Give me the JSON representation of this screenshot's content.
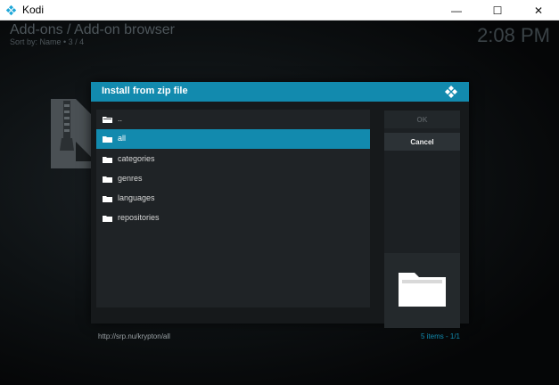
{
  "window": {
    "title": "Kodi",
    "minimize_glyph": "—",
    "maximize_glyph": "☐",
    "close_glyph": "✕"
  },
  "header": {
    "title": "Add-ons / Add-on browser",
    "sort": "Sort by: Name • 3 / 4",
    "clock": "2:08 PM"
  },
  "dialog": {
    "title": "Install from zip file",
    "items": [
      {
        "label": "..",
        "icon": "parent-folder-icon"
      },
      {
        "label": "all",
        "icon": "folder-icon",
        "selected": true
      },
      {
        "label": "categories",
        "icon": "folder-icon"
      },
      {
        "label": "genres",
        "icon": "folder-icon"
      },
      {
        "label": "languages",
        "icon": "folder-icon"
      },
      {
        "label": "repositories",
        "icon": "folder-icon"
      }
    ],
    "ok_label": "OK",
    "cancel_label": "Cancel",
    "path": "http://srp.nu/krypton/all",
    "count": "5 items - 1/1"
  },
  "colors": {
    "accent": "#128aae",
    "dialog_bg": "#16191b",
    "list_bg": "#1f2326"
  }
}
